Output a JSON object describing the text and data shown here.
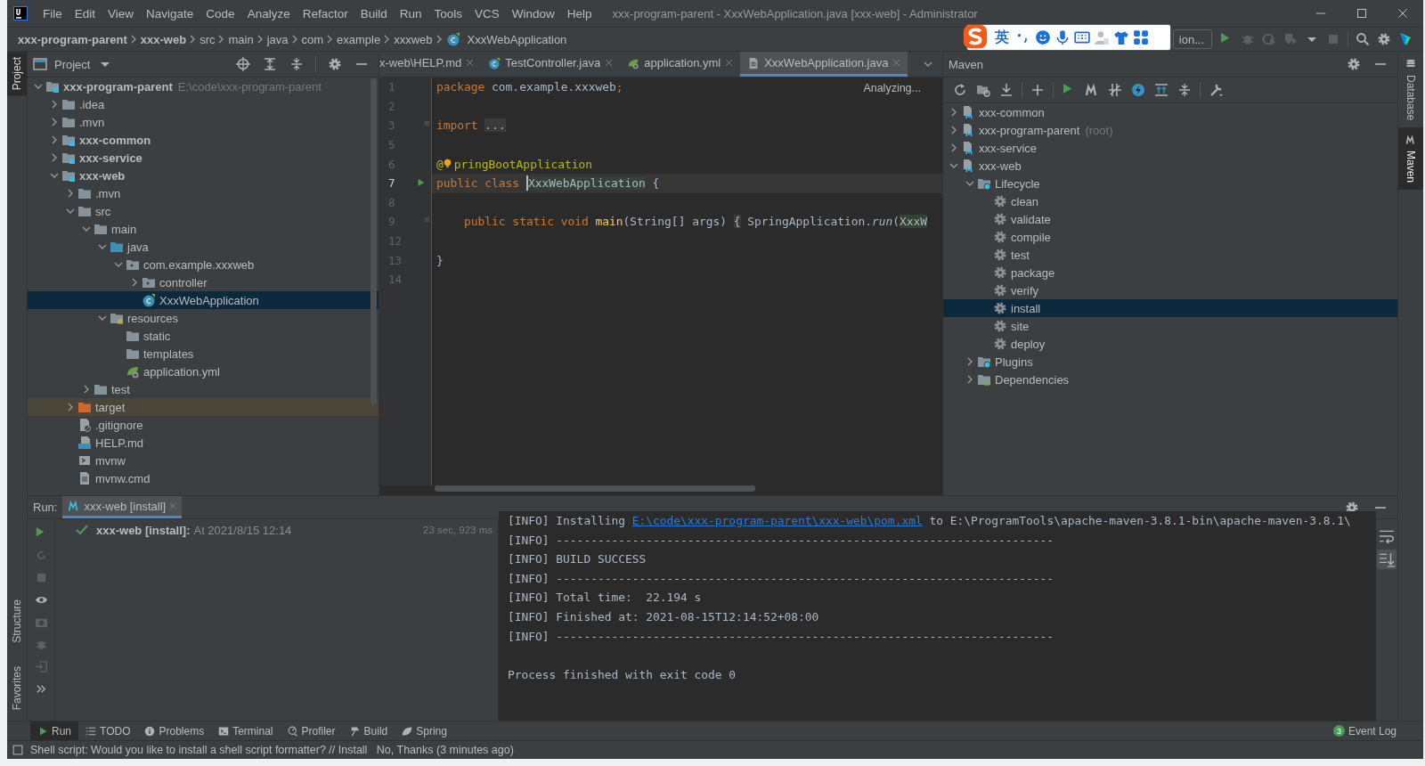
{
  "window": {
    "title": "xxx-program-parent - XxxWebApplication.java [xxx-web] - Administrator"
  },
  "menu": [
    "File",
    "Edit",
    "View",
    "Navigate",
    "Code",
    "Analyze",
    "Refactor",
    "Build",
    "Run",
    "Tools",
    "VCS",
    "Window",
    "Help"
  ],
  "breadcrumbs": [
    {
      "label": "xxx-program-parent",
      "bold": true
    },
    {
      "label": "xxx-web",
      "bold": true
    },
    {
      "label": "src"
    },
    {
      "label": "main"
    },
    {
      "label": "java"
    },
    {
      "label": "com"
    },
    {
      "label": "example"
    },
    {
      "label": "xxxweb"
    },
    {
      "label": "XxxWebApplication",
      "kind": "class"
    }
  ],
  "ime_toolbar": {
    "mode": "英"
  },
  "run_config": {
    "label": "ion..."
  },
  "left_stripe": {
    "top": {
      "label": "Project",
      "selected": true
    },
    "bottom": [
      {
        "label": "Structure",
        "selected": false
      },
      {
        "label": "Favorites",
        "selected": false
      }
    ]
  },
  "right_stripe": [
    {
      "label": "Database",
      "selected": false
    },
    {
      "label": "Maven",
      "selected": true
    }
  ],
  "project": {
    "title": "Project",
    "tree": [
      {
        "label": "xxx-program-parent",
        "hint": "E:\\code\\xxx-program-parent",
        "kind": "module",
        "bold": true,
        "expanded": true,
        "selected": false,
        "children": [
          {
            "label": ".idea",
            "kind": "folder",
            "expanded": false,
            "selected": false
          },
          {
            "label": ".mvn",
            "kind": "folder",
            "expanded": false,
            "selected": false
          },
          {
            "label": "xxx-common",
            "kind": "module",
            "bold": true,
            "expanded": false,
            "selected": false
          },
          {
            "label": "xxx-service",
            "kind": "module",
            "bold": true,
            "expanded": false,
            "selected": false
          },
          {
            "label": "xxx-web",
            "kind": "module",
            "bold": true,
            "expanded": true,
            "selected": false,
            "children": [
              {
                "label": ".mvn",
                "kind": "folder",
                "expanded": false,
                "selected": false
              },
              {
                "label": "src",
                "kind": "folder",
                "expanded": true,
                "selected": false,
                "children": [
                  {
                    "label": "main",
                    "kind": "folder",
                    "expanded": true,
                    "selected": false,
                    "children": [
                      {
                        "label": "java",
                        "kind": "source",
                        "expanded": true,
                        "selected": false,
                        "children": [
                          {
                            "label": "com.example.xxxweb",
                            "kind": "package",
                            "expanded": true,
                            "selected": false,
                            "children": [
                              {
                                "label": "controller",
                                "kind": "package",
                                "expanded": false,
                                "selected": false
                              },
                              {
                                "label": "XxxWebApplication",
                                "kind": "class",
                                "selected": true
                              }
                            ]
                          }
                        ]
                      },
                      {
                        "label": "resources",
                        "kind": "resources",
                        "expanded": true,
                        "selected": false,
                        "children": [
                          {
                            "label": "static",
                            "kind": "folder",
                            "selected": false
                          },
                          {
                            "label": "templates",
                            "kind": "folder",
                            "selected": false
                          },
                          {
                            "label": "application.yml",
                            "kind": "yml",
                            "selected": false
                          }
                        ]
                      }
                    ]
                  },
                  {
                    "label": "test",
                    "kind": "folder",
                    "expanded": false,
                    "selected": false
                  }
                ]
              },
              {
                "label": "target",
                "kind": "excluded",
                "expanded": false,
                "selected": false
              },
              {
                "label": ".gitignore",
                "kind": "gitignore",
                "selected": false
              },
              {
                "label": "HELP.md",
                "kind": "md",
                "selected": false
              },
              {
                "label": "mvnw",
                "kind": "script",
                "selected": false
              },
              {
                "label": "mvnw.cmd",
                "kind": "file",
                "selected": false
              }
            ]
          }
        ]
      }
    ]
  },
  "editor": {
    "tabs": [
      {
        "label": "x-web\\HELP.md",
        "selected": false
      },
      {
        "label": "TestController.java",
        "kind": "class",
        "selected": false
      },
      {
        "label": "application.yml",
        "kind": "yml",
        "selected": false
      },
      {
        "label": "XxxWebApplication.java",
        "kind": "file",
        "selected": true
      }
    ],
    "status": "Analyzing...",
    "lines": [
      {
        "number": "1",
        "current": false,
        "tokens": [
          {
            "kind": "keyword",
            "text": "package"
          },
          {
            "kind": "plain",
            "text": " com.example.xxxweb"
          },
          {
            "kind": "keyword",
            "text": ";"
          }
        ]
      },
      {
        "number": "2",
        "current": false
      },
      {
        "number": "3",
        "current": false,
        "fold": true,
        "tokens": [
          {
            "kind": "keyword",
            "text": "import "
          },
          {
            "kind": "folded",
            "text": "..."
          }
        ]
      },
      {
        "number": "5",
        "current": false
      },
      {
        "number": "6",
        "current": false,
        "tokens": [
          {
            "kind": "annotation",
            "text": "@"
          },
          {
            "kind": "bulb"
          },
          {
            "kind": "annotation",
            "text": "pringBootApplication"
          }
        ]
      },
      {
        "number": "7",
        "current": true,
        "run_marker": true,
        "tokens": [
          {
            "kind": "keyword",
            "text": "public class "
          },
          {
            "kind": "caret"
          },
          {
            "kind": "usage",
            "text": "XxxWebApplication"
          },
          {
            "kind": "plain",
            "text": " {"
          }
        ]
      },
      {
        "number": "8",
        "current": false
      },
      {
        "number": "9",
        "current": false,
        "fold": true,
        "tokens": [
          {
            "kind": "keyword",
            "text": "    public static void "
          },
          {
            "kind": "method",
            "text": "main"
          },
          {
            "kind": "plain",
            "text": "(String[] args) "
          },
          {
            "kind": "folded",
            "text": "{"
          },
          {
            "kind": "plain",
            "text": " SpringApplication."
          },
          {
            "kind": "static",
            "text": "run"
          },
          {
            "kind": "plain",
            "text": "("
          },
          {
            "kind": "usage",
            "text": "XxxW"
          }
        ]
      },
      {
        "number": "12",
        "current": false
      },
      {
        "number": "13",
        "current": false,
        "tokens": [
          {
            "kind": "plain",
            "text": "}"
          }
        ]
      },
      {
        "number": "14",
        "current": false
      }
    ]
  },
  "maven": {
    "title": "Maven",
    "tree": [
      {
        "label": "xxx-common",
        "kind": "maven-module",
        "expanded": false,
        "selected": false
      },
      {
        "label": "xxx-program-parent",
        "hint": "(root)",
        "kind": "maven-module",
        "expanded": false,
        "selected": false
      },
      {
        "label": "xxx-service",
        "kind": "maven-module",
        "expanded": false,
        "selected": false
      },
      {
        "label": "xxx-web",
        "kind": "maven-module",
        "expanded": true,
        "selected": false,
        "children": [
          {
            "label": "Lifecycle",
            "kind": "lifecycle",
            "expanded": true,
            "selected": false,
            "children": [
              {
                "label": "clean",
                "kind": "goal",
                "selected": false
              },
              {
                "label": "validate",
                "kind": "goal",
                "selected": false
              },
              {
                "label": "compile",
                "kind": "goal",
                "selected": false
              },
              {
                "label": "test",
                "kind": "goal",
                "selected": false
              },
              {
                "label": "package",
                "kind": "goal",
                "selected": false
              },
              {
                "label": "verify",
                "kind": "goal",
                "selected": false
              },
              {
                "label": "install",
                "kind": "goal",
                "selected": true
              },
              {
                "label": "site",
                "kind": "goal",
                "selected": false
              },
              {
                "label": "deploy",
                "kind": "goal",
                "selected": false
              }
            ]
          },
          {
            "label": "Plugins",
            "kind": "lifecycle",
            "expanded": false,
            "selected": false
          },
          {
            "label": "Dependencies",
            "kind": "dependencies",
            "expanded": false,
            "selected": false
          }
        ]
      }
    ]
  },
  "run": {
    "label": "Run:",
    "tab": "xxx-web [install]",
    "entry": {
      "name": "xxx-web [install]:",
      "detail": "At 2021/8/15 12:14",
      "duration": "23 sec, 923 ms"
    },
    "console": [
      {
        "segments": [
          {
            "kind": "tag",
            "text": "[INFO]"
          },
          {
            "kind": "plain",
            "text": " Installing "
          },
          {
            "kind": "link",
            "text": "E:\\code\\xxx-program-parent\\xxx-web\\pom.xml"
          },
          {
            "kind": "plain",
            "text": " to E:\\ProgramTools\\apache-maven-3.8.1-bin\\apache-maven-3.8.1\\"
          }
        ]
      },
      {
        "segments": [
          {
            "kind": "tag",
            "text": "[INFO]"
          },
          {
            "kind": "plain",
            "text": " ------------------------------------------------------------------------"
          }
        ]
      },
      {
        "segments": [
          {
            "kind": "tag",
            "text": "[INFO]"
          },
          {
            "kind": "plain",
            "text": " BUILD SUCCESS"
          }
        ]
      },
      {
        "segments": [
          {
            "kind": "tag",
            "text": "[INFO]"
          },
          {
            "kind": "plain",
            "text": " ------------------------------------------------------------------------"
          }
        ]
      },
      {
        "segments": [
          {
            "kind": "tag",
            "text": "[INFO]"
          },
          {
            "kind": "plain",
            "text": " Total time:  22.194 s"
          }
        ]
      },
      {
        "segments": [
          {
            "kind": "tag",
            "text": "[INFO]"
          },
          {
            "kind": "plain",
            "text": " Finished at: 2021-08-15T12:14:52+08:00"
          }
        ]
      },
      {
        "segments": [
          {
            "kind": "tag",
            "text": "[INFO]"
          },
          {
            "kind": "plain",
            "text": " ------------------------------------------------------------------------"
          }
        ]
      },
      {
        "blank_before": true,
        "segments": [
          {
            "kind": "plain",
            "text": "Process finished with exit code 0"
          }
        ]
      }
    ]
  },
  "tool_tabs": [
    {
      "label": "Run",
      "kind": "play",
      "selected": true
    },
    {
      "label": "TODO",
      "kind": "list",
      "selected": false
    },
    {
      "label": "Problems",
      "kind": "info",
      "selected": false
    },
    {
      "label": "Terminal",
      "kind": "terminal",
      "selected": false
    },
    {
      "label": "Profiler",
      "kind": "profiler",
      "selected": false
    },
    {
      "label": "Build",
      "kind": "hammer",
      "selected": false
    },
    {
      "label": "Spring",
      "kind": "leaf",
      "selected": false
    }
  ],
  "event_log": {
    "label": "Event Log",
    "count": "3"
  },
  "status_bar": {
    "message": "Shell script: Would you like to install a shell script formatter? // Install   No, Thanks (3 minutes ago)"
  }
}
